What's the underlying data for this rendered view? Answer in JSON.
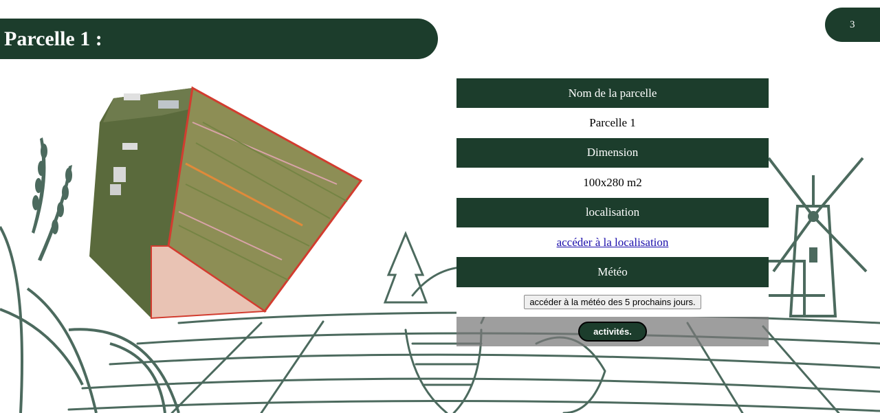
{
  "page": {
    "title": "Parcelle 1 :",
    "page_number": "3"
  },
  "colors": {
    "dark_green": "#1c3d2c",
    "sketch_green": "#4c6a5e",
    "link_blue": "#1a0dab",
    "parcel_border": "#d23c2f"
  },
  "image": {
    "subject": "aerial-parcel-photo"
  },
  "info_table": {
    "name_header": "Nom de la parcelle",
    "name_value": "Parcelle 1",
    "dimension_header": "Dimension",
    "dimension_value": "100x280 m2",
    "location_header": "localisation",
    "location_link": "accéder à la localisation",
    "weather_header": "Météo",
    "weather_button": "accéder à la météo des 5 prochains jours.",
    "activities_button": "activités."
  }
}
